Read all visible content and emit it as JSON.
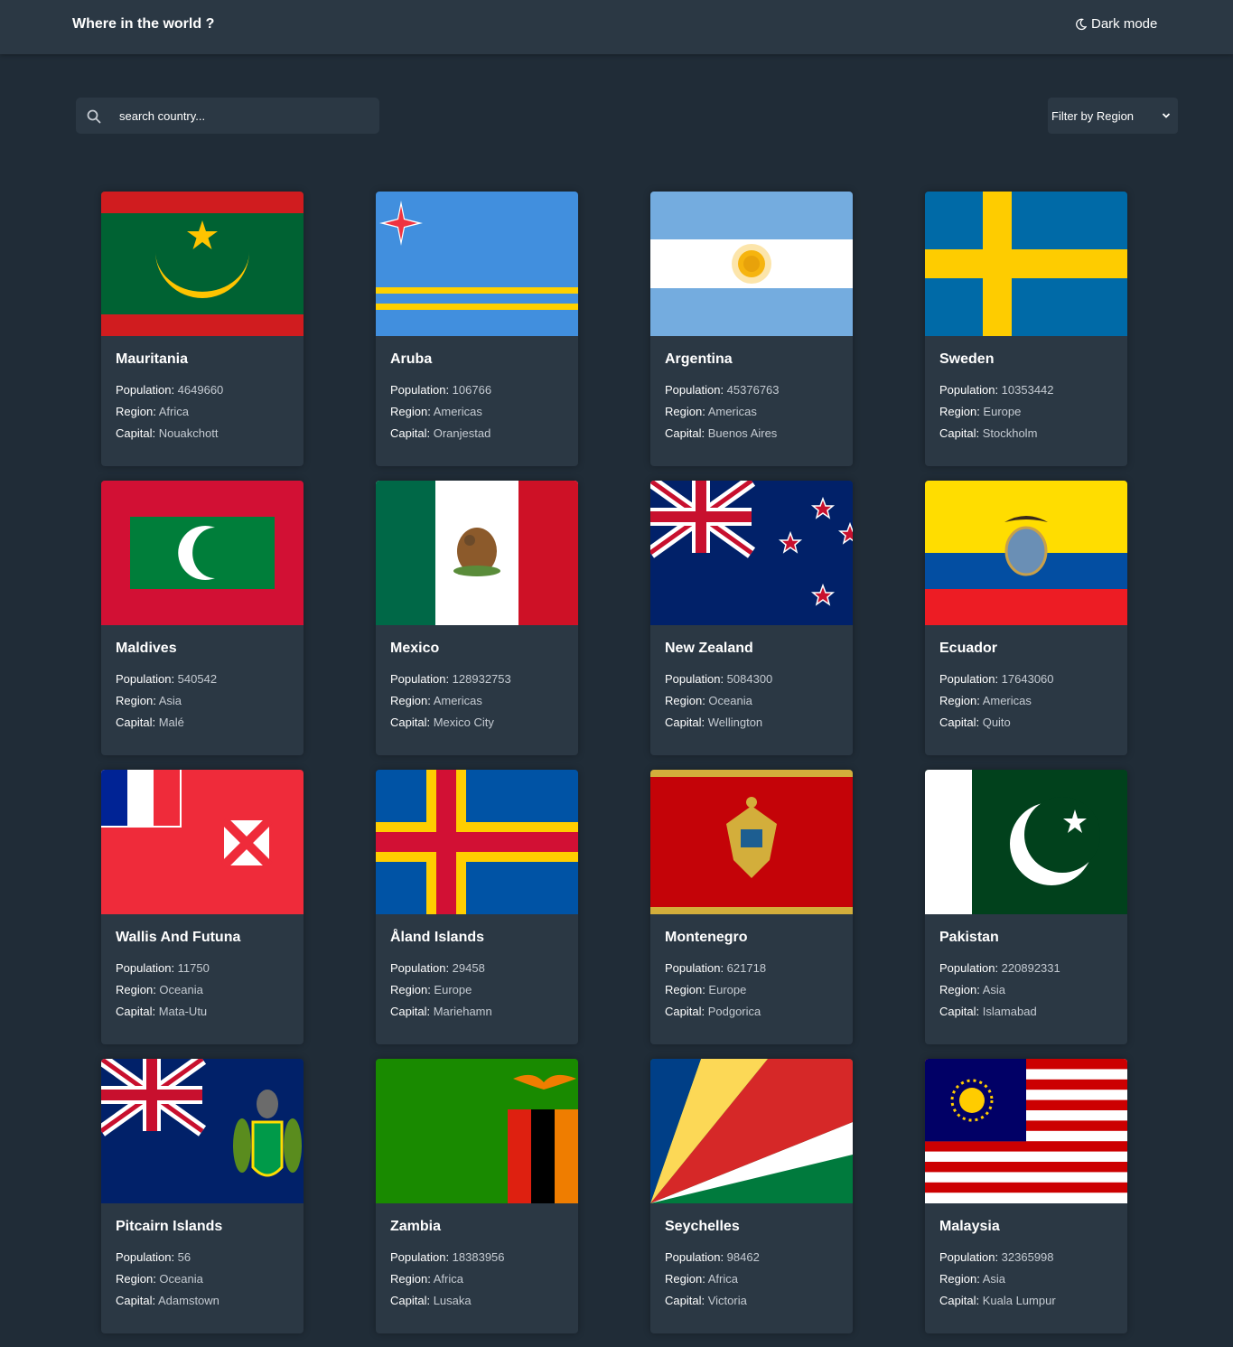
{
  "header": {
    "title": "Where in the world ?",
    "mode_label": "Dark mode"
  },
  "search": {
    "placeholder": "search country..."
  },
  "filter": {
    "label": "Filter by Region"
  },
  "labels": {
    "population": "Population: ",
    "region": "Region: ",
    "capital": "Capital: "
  },
  "countries": [
    {
      "name": "Mauritania",
      "population": "4649660",
      "region": "Africa",
      "capital": "Nouakchott",
      "flag": "mauritania"
    },
    {
      "name": "Aruba",
      "population": "106766",
      "region": "Americas",
      "capital": "Oranjestad",
      "flag": "aruba"
    },
    {
      "name": "Argentina",
      "population": "45376763",
      "region": "Americas",
      "capital": "Buenos Aires",
      "flag": "argentina"
    },
    {
      "name": "Sweden",
      "population": "10353442",
      "region": "Europe",
      "capital": "Stockholm",
      "flag": "sweden"
    },
    {
      "name": "Maldives",
      "population": "540542",
      "region": "Asia",
      "capital": "Malé",
      "flag": "maldives"
    },
    {
      "name": "Mexico",
      "population": "128932753",
      "region": "Americas",
      "capital": "Mexico City",
      "flag": "mexico"
    },
    {
      "name": "New Zealand",
      "population": "5084300",
      "region": "Oceania",
      "capital": "Wellington",
      "flag": "new-zealand"
    },
    {
      "name": "Ecuador",
      "population": "17643060",
      "region": "Americas",
      "capital": "Quito",
      "flag": "ecuador"
    },
    {
      "name": "Wallis And Futuna",
      "population": "11750",
      "region": "Oceania",
      "capital": "Mata-Utu",
      "flag": "wallis-futuna"
    },
    {
      "name": "Åland Islands",
      "population": "29458",
      "region": "Europe",
      "capital": "Mariehamn",
      "flag": "aland"
    },
    {
      "name": "Montenegro",
      "population": "621718",
      "region": "Europe",
      "capital": "Podgorica",
      "flag": "montenegro"
    },
    {
      "name": "Pakistan",
      "population": "220892331",
      "region": "Asia",
      "capital": "Islamabad",
      "flag": "pakistan"
    },
    {
      "name": "Pitcairn Islands",
      "population": "56",
      "region": "Oceania",
      "capital": "Adamstown",
      "flag": "pitcairn"
    },
    {
      "name": "Zambia",
      "population": "18383956",
      "region": "Africa",
      "capital": "Lusaka",
      "flag": "zambia"
    },
    {
      "name": "Seychelles",
      "population": "98462",
      "region": "Africa",
      "capital": "Victoria",
      "flag": "seychelles"
    },
    {
      "name": "Malaysia",
      "population": "32365998",
      "region": "Asia",
      "capital": "Kuala Lumpur",
      "flag": "malaysia"
    }
  ]
}
